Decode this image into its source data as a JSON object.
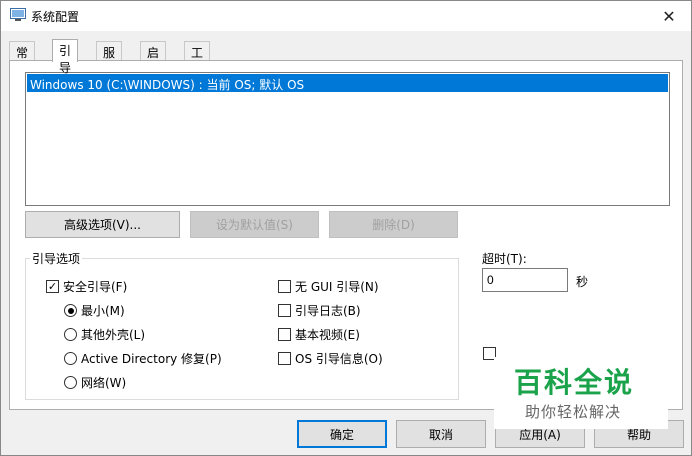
{
  "window": {
    "title": "系统配置",
    "close_glyph": "✕"
  },
  "tabs": [
    {
      "label": "常规"
    },
    {
      "label": "引导"
    },
    {
      "label": "服务"
    },
    {
      "label": "启动"
    },
    {
      "label": "工具"
    }
  ],
  "os_list": {
    "entries": [
      "Windows 10 (C:\\WINDOWS) : 当前 OS; 默认 OS"
    ]
  },
  "buttons": {
    "advanced": "高级选项(V)...",
    "set_default": "设为默认值(S)",
    "delete": "删除(D)"
  },
  "boot_options": {
    "group_title": "引导选项",
    "safe_boot": {
      "label": "安全引导(F)",
      "checked": true
    },
    "minimal": {
      "label": "最小(M)",
      "selected": true
    },
    "alternate_shell": {
      "label": "其他外壳(L)",
      "selected": false
    },
    "active_directory": {
      "label": "Active Directory 修复(P)",
      "selected": false
    },
    "network": {
      "label": "网络(W)",
      "selected": false
    },
    "no_gui": {
      "label": "无 GUI 引导(N)",
      "checked": false
    },
    "boot_log": {
      "label": "引导日志(B)",
      "checked": false
    },
    "base_video": {
      "label": "基本视频(E)",
      "checked": false
    },
    "os_boot_info": {
      "label": "OS 引导信息(O)",
      "checked": false
    }
  },
  "timeout": {
    "label": "超时(T):",
    "value": "0",
    "unit": "秒"
  },
  "footer": {
    "ok": "确定",
    "cancel": "取消",
    "apply": "应用(A)",
    "help": "帮助"
  },
  "watermark": {
    "main": "百科全说",
    "sub": "助你轻松解决"
  },
  "colors": {
    "selection": "#0078d7",
    "watermark_green": "#1aa34a"
  }
}
